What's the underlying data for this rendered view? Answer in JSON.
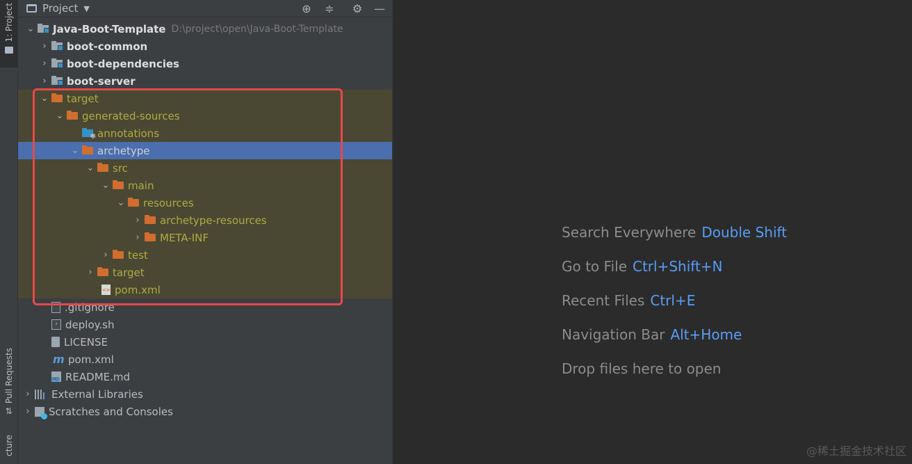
{
  "tool_strip": {
    "project_tab": "1: Project",
    "pull_requests_tab": "Pull Requests",
    "structure_tab": "cture"
  },
  "panel": {
    "title": "Project",
    "dropdown": "▼"
  },
  "tree": [
    {
      "label": "Java-Boot-Template",
      "hint": "D:\\project\\open\\Java-Boot-Template"
    },
    {
      "label": "boot-common"
    },
    {
      "label": "boot-dependencies"
    },
    {
      "label": "boot-server"
    },
    {
      "label": "target"
    },
    {
      "label": "generated-sources"
    },
    {
      "label": "annotations"
    },
    {
      "label": "archetype"
    },
    {
      "label": "src"
    },
    {
      "label": "main"
    },
    {
      "label": "resources"
    },
    {
      "label": "archetype-resources"
    },
    {
      "label": "META-INF"
    },
    {
      "label": "test"
    },
    {
      "label": "target"
    },
    {
      "label": "pom.xml"
    },
    {
      "label": ".gitignore"
    },
    {
      "label": "deploy.sh"
    },
    {
      "label": "LICENSE"
    },
    {
      "label": "pom.xml"
    },
    {
      "label": "README.md"
    },
    {
      "label": "External Libraries"
    },
    {
      "label": "Scratches and Consoles"
    }
  ],
  "editor_hints": [
    {
      "text": "Search Everywhere",
      "key": "Double Shift"
    },
    {
      "text": "Go to File",
      "key": "Ctrl+Shift+N"
    },
    {
      "text": "Recent Files",
      "key": "Ctrl+E"
    },
    {
      "text": "Navigation Bar",
      "key": "Alt+Home"
    },
    {
      "text": "Drop files here to open",
      "key": ""
    }
  ],
  "watermark": "@稀土掘金技术社区",
  "colors": {
    "selection": "#4b6eaf",
    "excluded_bg": "#4a4733",
    "excluded_text": "#afac44",
    "annotation_red": "#e8484a",
    "shortcut_blue": "#589df6"
  }
}
